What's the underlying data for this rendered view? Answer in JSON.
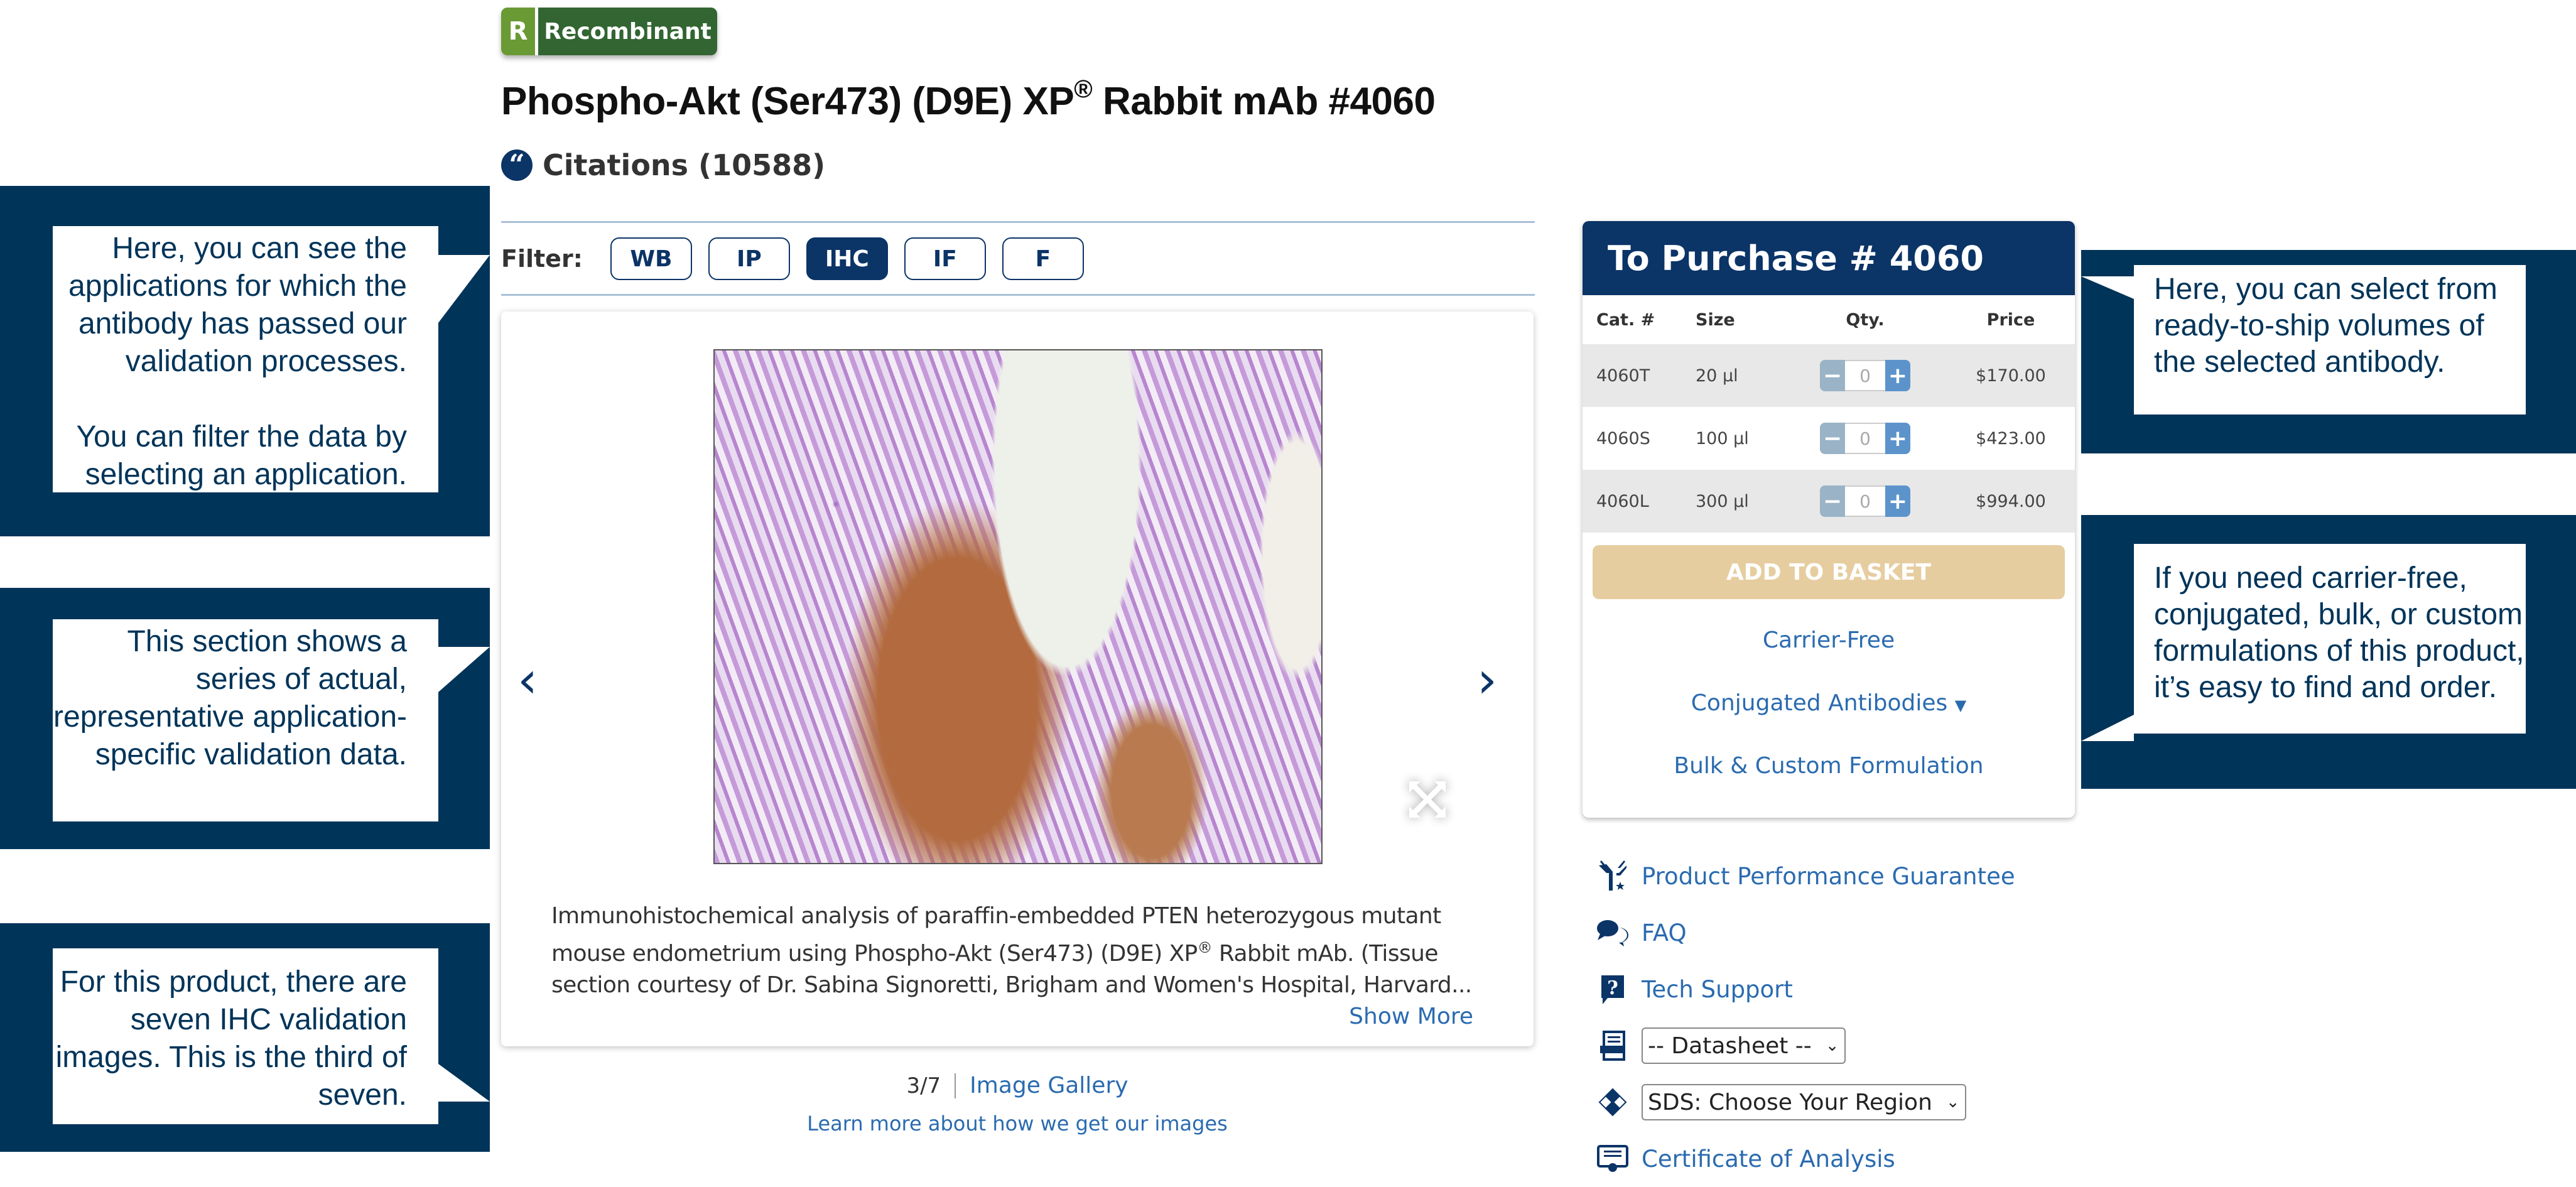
{
  "badge": {
    "letter": "R",
    "label": "Recombinant"
  },
  "product": {
    "title_main": "Phospho-Akt (Ser473) (D9E) XP",
    "title_reg": "®",
    "title_tail": " Rabbit mAb #4060",
    "citations": "Citations (10588)"
  },
  "filter": {
    "label": "Filter:",
    "options": [
      {
        "label": "WB",
        "active": false
      },
      {
        "label": "IP",
        "active": false
      },
      {
        "label": "IHC",
        "active": true
      },
      {
        "label": "IF",
        "active": false
      },
      {
        "label": "F",
        "active": false
      }
    ]
  },
  "gallery": {
    "image_alt": "IHC staining of PTEN heterozygous mutant mouse endometrium",
    "caption_part1": "Immunohistochemical analysis of paraffin-embedded PTEN heterozygous mutant mouse endometrium using Phospho-Akt (Ser473) (D9E) XP",
    "caption_reg": "®",
    "caption_part2": " Rabbit mAb. (Tissue section courtesy of Dr. Sabina Signoretti, Brigham and Women's Hospital, Harvard...",
    "show_more": "Show More",
    "position": "3/7",
    "current_index": 3,
    "total": 7,
    "gallery_link": "Image Gallery",
    "learn_more": "Learn more about how we get our images"
  },
  "purchase": {
    "title": "To Purchase # 4060",
    "headers": [
      "Cat. #",
      "Size",
      "Qty.",
      "Price"
    ],
    "rows": [
      {
        "cat": "4060T",
        "size": "20 µl",
        "qty": "0",
        "price": "$170.00"
      },
      {
        "cat": "4060S",
        "size": "100 µl",
        "qty": "0",
        "price": "$423.00"
      },
      {
        "cat": "4060L",
        "size": "300 µl",
        "qty": "0",
        "price": "$994.00"
      }
    ],
    "add_to_basket": "ADD TO BASKET",
    "links": {
      "carrier_free": "Carrier-Free",
      "conjugated": "Conjugated Antibodies",
      "bulk": "Bulk & Custom Formulation"
    }
  },
  "side_links": {
    "guarantee": "Product Performance Guarantee",
    "faq": "FAQ",
    "tech_support": "Tech Support",
    "datasheet_select": "-- Datasheet --",
    "sds_select": "SDS: Choose Your Region",
    "coa": "Certificate of Analysis"
  },
  "callouts": {
    "filter_note_1": "Here, you can see the applications for which the antibody has passed our validation processes.",
    "filter_note_2": "You can filter the data by selecting an application.",
    "gallery_note": "This section shows a series of actual, representative application-specific validation data.",
    "count_note": "For this product, there are seven IHC validation images. This is the third of seven.",
    "purchase_note": "Here, you can select from ready-to-ship volumes of the selected antibody.",
    "formulations_note": "If you need carrier-free, conjugated, bulk, or custom formulations of this product, it’s easy to find and order."
  },
  "colors": {
    "brand_navy": "#0b3467",
    "callout_navy": "#003459",
    "link_blue": "#2a6bb0",
    "basket_tan": "#e6cda0",
    "recombinant_green": "#326532"
  }
}
